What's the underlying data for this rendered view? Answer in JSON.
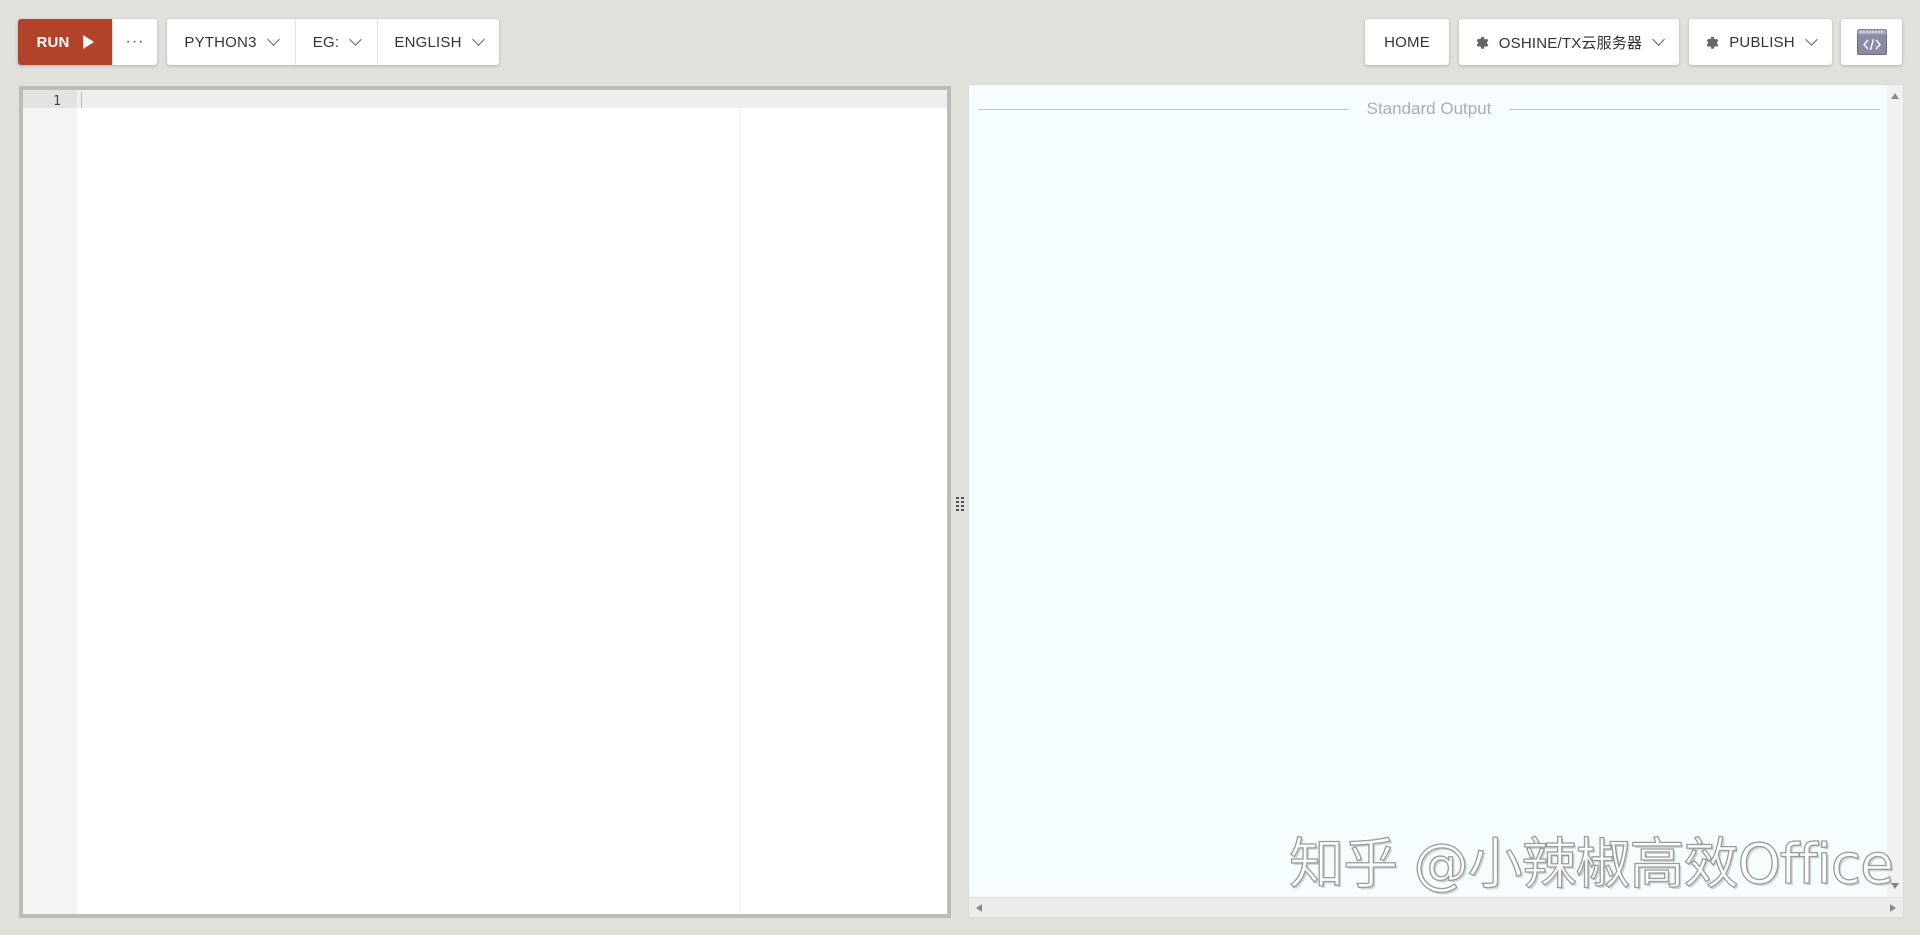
{
  "toolbar": {
    "run_label": "RUN",
    "more_label": "···",
    "language_label": "PYTHON3",
    "example_label": "EG:",
    "locale_label": "ENGLISH",
    "home_label": "HOME",
    "server_label": "OSHINE/TX云服务器",
    "publish_label": "PUBLISH"
  },
  "icons": {
    "run": "play-icon",
    "more": "ellipsis-icon",
    "dropdown": "chevron-down-icon",
    "settings": "gear-icon",
    "embed": "code-embed-icon"
  },
  "editor": {
    "line_numbers": [
      "1"
    ]
  },
  "output": {
    "header": "Standard Output",
    "watermark": "知乎 @小辣椒高效Office"
  },
  "colors": {
    "run_button": "#b1432b",
    "background": "#e1e1dc",
    "output_background": "#f6fdfe",
    "editor_border": "#bcbcb6"
  }
}
